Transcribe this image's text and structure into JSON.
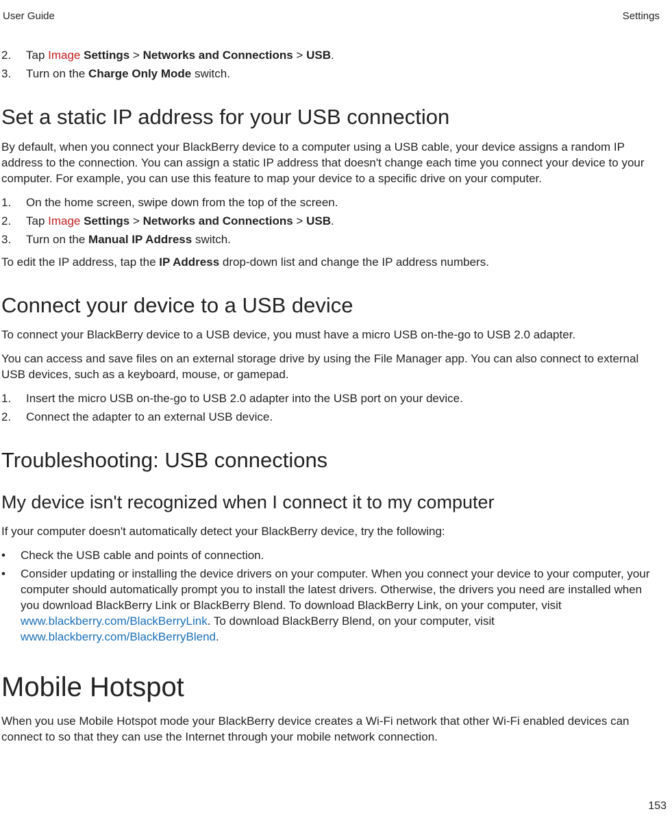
{
  "header": {
    "left": "User Guide",
    "right": "Settings"
  },
  "topSteps": {
    "s2_num": "2.",
    "s2_a": "Tap ",
    "s2_img": "Image",
    "s2_b": " Settings",
    "s2_c": " > ",
    "s2_d": "Networks and Connections",
    "s2_e": " > ",
    "s2_f": "USB",
    "s2_g": ".",
    "s3_num": "3.",
    "s3_a": "Turn on the ",
    "s3_b": "Charge Only Mode",
    "s3_c": " switch."
  },
  "staticIp": {
    "heading": "Set a static IP address for your USB connection",
    "para": "By default, when you connect your BlackBerry device to a computer using a USB cable, your device assigns a random IP address to the connection. You can assign a static IP address that doesn't change each time you connect your device to your computer. For example, you can use this feature to map your device to a specific drive on your computer.",
    "s1_num": "1.",
    "s1": "On the home screen, swipe down from the top of the screen.",
    "s2_num": "2.",
    "s2_a": "Tap ",
    "s2_img": "Image",
    "s2_b": " Settings",
    "s2_c": " > ",
    "s2_d": "Networks and Connections",
    "s2_e": " > ",
    "s2_f": "USB",
    "s2_g": ".",
    "s3_num": "3.",
    "s3_a": "Turn on the ",
    "s3_b": "Manual IP Address",
    "s3_c": " switch.",
    "after_a": "To edit the IP address, tap the ",
    "after_b": "IP Address",
    "after_c": " drop-down list and change the IP address numbers."
  },
  "usbDevice": {
    "heading": "Connect your device to a USB device",
    "para1": "To connect your BlackBerry device to a USB device, you must have a micro USB on-the-go to USB 2.0 adapter.",
    "para2": "You can access and save files on an external storage drive by using the File Manager app. You can also connect to external USB devices, such as a keyboard, mouse, or gamepad.",
    "s1_num": "1.",
    "s1": "Insert the micro USB on-the-go to USB 2.0 adapter into the USB port on your device.",
    "s2_num": "2.",
    "s2": "Connect the adapter to an external USB device."
  },
  "trouble": {
    "heading": "Troubleshooting: USB connections",
    "sub": "My device isn't recognized when I connect it to my computer",
    "para": "If your computer doesn't automatically detect your BlackBerry device, try the following:",
    "b1": "Check the USB cable and points of connection.",
    "b2_a": "Consider updating or installing the device drivers on your computer. When you connect your device to your computer, your computer should automatically prompt you to install the latest drivers. Otherwise, the drivers you need are installed when you download BlackBerry Link or BlackBerry Blend. To download BlackBerry Link, on your computer, visit ",
    "b2_link1": "www.blackberry.com/BlackBerryLink",
    "b2_b": ". To download BlackBerry Blend, on your computer, visit ",
    "b2_link2": "www.blackberry.com/BlackBerryBlend",
    "b2_c": "."
  },
  "hotspot": {
    "heading": "Mobile Hotspot",
    "para": "When you use Mobile Hotspot mode your BlackBerry device creates a Wi-Fi network that other Wi-Fi enabled devices can connect to so that they can use the Internet through your mobile network connection."
  },
  "pagenum": "153",
  "bullet": "•"
}
